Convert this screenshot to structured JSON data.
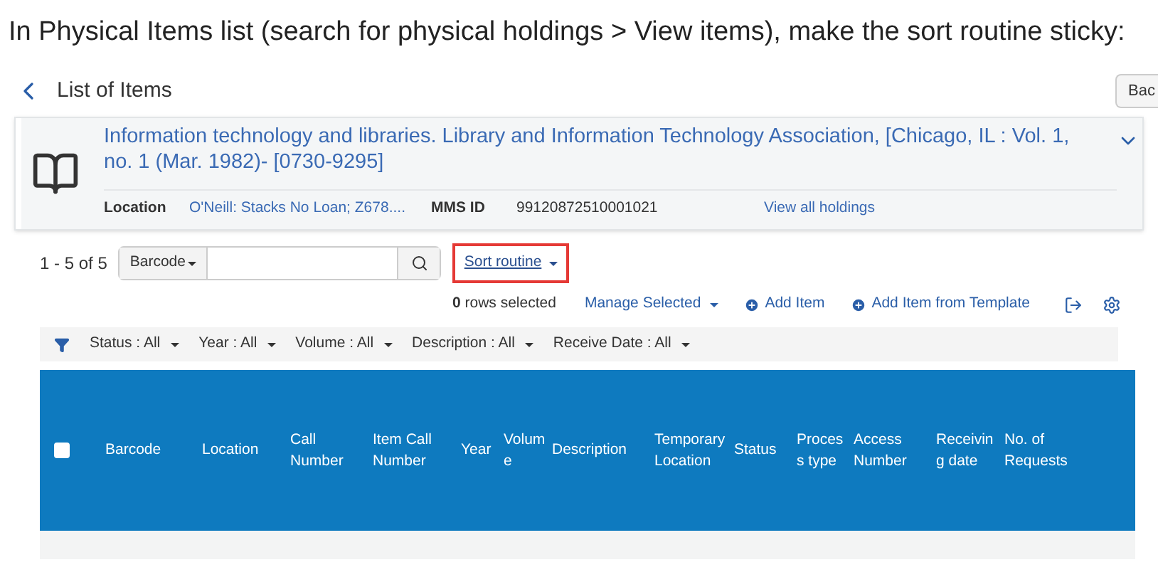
{
  "caption": "In Physical Items list (search for physical holdings > View items), make the sort routine sticky:",
  "header": {
    "title": "List of Items",
    "back_button": "Bac"
  },
  "record": {
    "title": "Information technology and libraries. Library and Information Technology Association, [Chicago, IL : Vol. 1, no. 1 (Mar. 1982)- [0730-9295]",
    "location_label": "Location",
    "location": "O'Neill: Stacks No Loan; Z678....",
    "mms_label": "MMS ID",
    "mms_id": "99120872510001021",
    "link": "View all holdings"
  },
  "toolbar": {
    "count": "1 - 5 of 5",
    "search_scope": "Barcode",
    "sort": "Sort routine",
    "sort_highlighted": true
  },
  "actions": {
    "rows_selected_count": "0",
    "rows_selected_text": "rows selected",
    "items": [
      "Manage Selected",
      "Add Item",
      "Add Item from Template"
    ]
  },
  "filters": [
    {
      "label": "Status : All"
    },
    {
      "label": "Year : All"
    },
    {
      "label": "Volume : All"
    },
    {
      "label": "Description : All"
    },
    {
      "label": "Receive Date : All"
    }
  ],
  "table": {
    "select_all_checked": false,
    "columns": [
      "Barcode",
      "Location",
      "Call Number",
      "Item Call Number",
      "Year",
      "Volume",
      "Description",
      "Temporary Location",
      "Status",
      "Process type",
      "Access Number",
      "Receiving date",
      "No. of Requests"
    ]
  }
}
